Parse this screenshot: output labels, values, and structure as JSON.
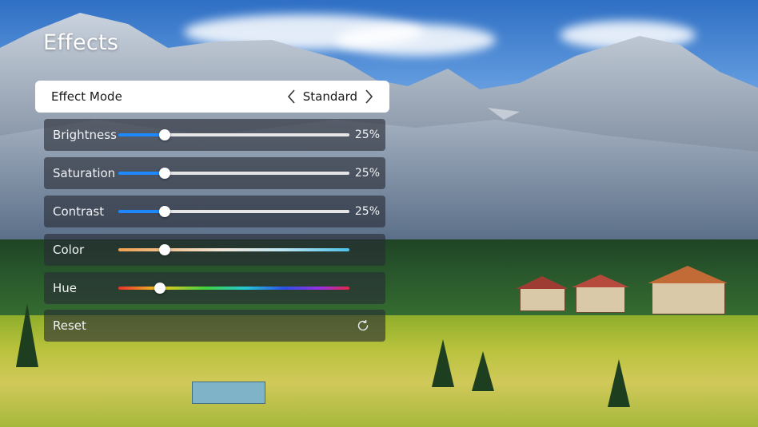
{
  "page": {
    "title": "Effects"
  },
  "effect_mode": {
    "label": "Effect Mode",
    "value": "Standard"
  },
  "sliders": [
    {
      "label": "Brightness",
      "value_text": "25%",
      "level": 0.2,
      "track": "blue"
    },
    {
      "label": "Saturation",
      "value_text": "25%",
      "level": 0.2,
      "track": "blue"
    },
    {
      "label": "Contrast",
      "value_text": "25%",
      "level": 0.2,
      "track": "blue"
    },
    {
      "label": "Color",
      "value_text": "",
      "level": 0.2,
      "track": "color-temperature"
    },
    {
      "label": "Hue",
      "value_text": "",
      "level": 0.18,
      "track": "rainbow"
    }
  ],
  "reset": {
    "label": "Reset",
    "icon": "refresh-icon"
  },
  "colors": {
    "accent": "#1e88ff",
    "track_bg": "#e6e6e6"
  }
}
